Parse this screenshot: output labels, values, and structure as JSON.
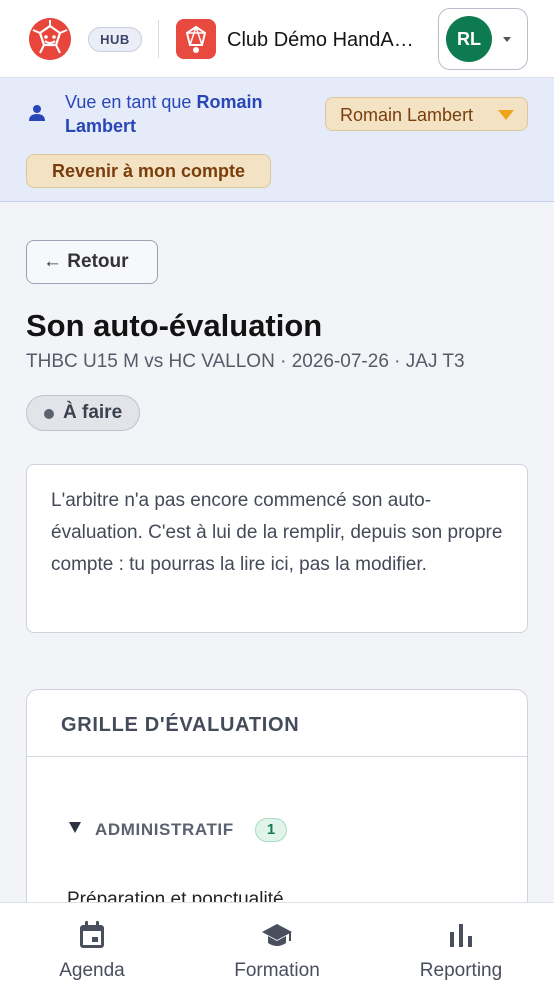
{
  "header": {
    "hub_badge": "HUB",
    "club_name": "Club Démo HandA…",
    "avatar_initials": "RL"
  },
  "impersonation": {
    "prefix": "Vue en tant que ",
    "user_name": "Romain Lambert",
    "selected_user": "Romain Lambert",
    "revert_label": "Revenir à mon compte"
  },
  "page": {
    "back_label": "← Retour",
    "title": "Son auto-évaluation",
    "subtitle": "THBC U15 M vs HC VALLON · 2026-07-26 · JAJ T3",
    "status": "À faire",
    "info_text": "L'arbitre n'a pas encore commencé son auto-évaluation. C'est à lui de la remplir, depuis son propre compte : tu pourras la lire ici, pas la modifier."
  },
  "grid": {
    "title": "GRILLE D'ÉVALUATION",
    "sections": [
      {
        "label": "ADMINISTRATIF",
        "count": "1",
        "items": [
          "Préparation et ponctualité"
        ]
      }
    ]
  },
  "bottom_nav": {
    "items": [
      {
        "label": "Agenda",
        "icon": "calendar-icon"
      },
      {
        "label": "Formation",
        "icon": "graduation-cap-icon"
      },
      {
        "label": "Reporting",
        "icon": "bar-chart-icon"
      }
    ]
  },
  "colors": {
    "accent_blue": "#2846b8",
    "banner_bg": "#e6ebf9",
    "warning_bg": "#f3e3c4",
    "warning_text": "#7a3d0c",
    "avatar_green": "#0e7a52",
    "brand_red": "#e8453c"
  }
}
